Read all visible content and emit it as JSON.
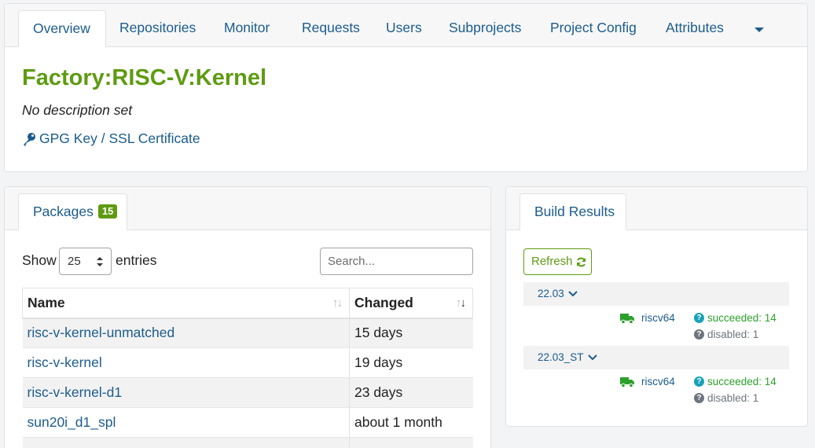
{
  "tabs": [
    "Overview",
    "Repositories",
    "Monitor",
    "Requests",
    "Users",
    "Subprojects",
    "Project Config",
    "Attributes"
  ],
  "project": {
    "title": "Factory:RISC-V:Kernel",
    "description": "No description set",
    "gpg_link": "GPG Key / SSL Certificate"
  },
  "packages": {
    "tab_label": "Packages",
    "count": "15",
    "show_label": "Show",
    "entries_label": "entries",
    "page_size": "25",
    "search_placeholder": "Search...",
    "columns": [
      "Name",
      "Changed"
    ],
    "rows": [
      {
        "name": "risc-v-kernel-unmatched",
        "changed": "15 days"
      },
      {
        "name": "risc-v-kernel",
        "changed": "19 days"
      },
      {
        "name": "risc-v-kernel-d1",
        "changed": "23 days"
      },
      {
        "name": "sun20i_d1_spl",
        "changed": "about 1 month"
      },
      {
        "name": "",
        "changed": ""
      }
    ]
  },
  "build_results": {
    "tab_label": "Build Results",
    "refresh_label": "Refresh",
    "repos": [
      {
        "name": "22.03",
        "arch": "riscv64",
        "succeeded": "succeeded: 14",
        "disabled": "disabled: 1"
      },
      {
        "name": "22.03_ST",
        "arch": "riscv64",
        "succeeded": "succeeded: 14",
        "disabled": "disabled: 1"
      }
    ]
  },
  "colors": {
    "accent_green": "#5e9b12",
    "link_blue": "#1b5c8e",
    "success": "#2ca02c",
    "info": "#17a2b8",
    "muted": "#6c757d"
  },
  "icons": {
    "gpg": "key-icon",
    "refresh": "refresh-icon",
    "repo_toggle": "chevron-down-icon",
    "arch": "truck-icon",
    "status": "question-circle-icon",
    "more_tabs": "caret-down-icon"
  }
}
